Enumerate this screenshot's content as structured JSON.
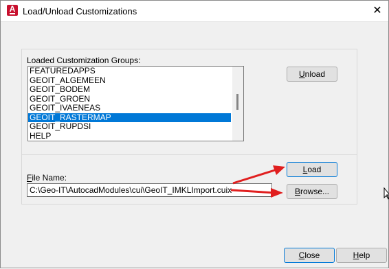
{
  "window": {
    "title": "Load/Unload Customizations",
    "close_icon": "close-icon",
    "app_icon": "autocad-icon",
    "app_icon_letter": "A"
  },
  "groups_section": {
    "label": "Loaded Customization Groups:",
    "items": [
      {
        "label": "FEATUREDAPPS",
        "selected": false
      },
      {
        "label": "GEOIT_ALGEMEEN",
        "selected": false
      },
      {
        "label": "GEOIT_BODEM",
        "selected": false
      },
      {
        "label": "GEOIT_GROEN",
        "selected": false
      },
      {
        "label": "GEOIT_IVAENEAS",
        "selected": false
      },
      {
        "label": "GEOIT_RASTERMAP",
        "selected": true
      },
      {
        "label": "GEOIT_RUPDSI",
        "selected": false
      },
      {
        "label": "HELP",
        "selected": false
      }
    ],
    "unload_button": {
      "mnemonic": "U",
      "rest": "nload"
    }
  },
  "file_section": {
    "label_mnemonic": "F",
    "label_rest": "ile Name:",
    "file_value": "C:\\Geo-IT\\AutocadModules\\cui\\GeoIT_IMKLImport.cuix",
    "load_button": {
      "mnemonic": "L",
      "rest": "oad"
    },
    "browse_button": {
      "mnemonic": "B",
      "rest": "rowse..."
    }
  },
  "footer": {
    "close_button": {
      "mnemonic": "C",
      "rest": "lose"
    },
    "help_button": {
      "mnemonic": "H",
      "rest": "elp"
    }
  },
  "annotation": {
    "arrow_color": "#e01e1e"
  }
}
